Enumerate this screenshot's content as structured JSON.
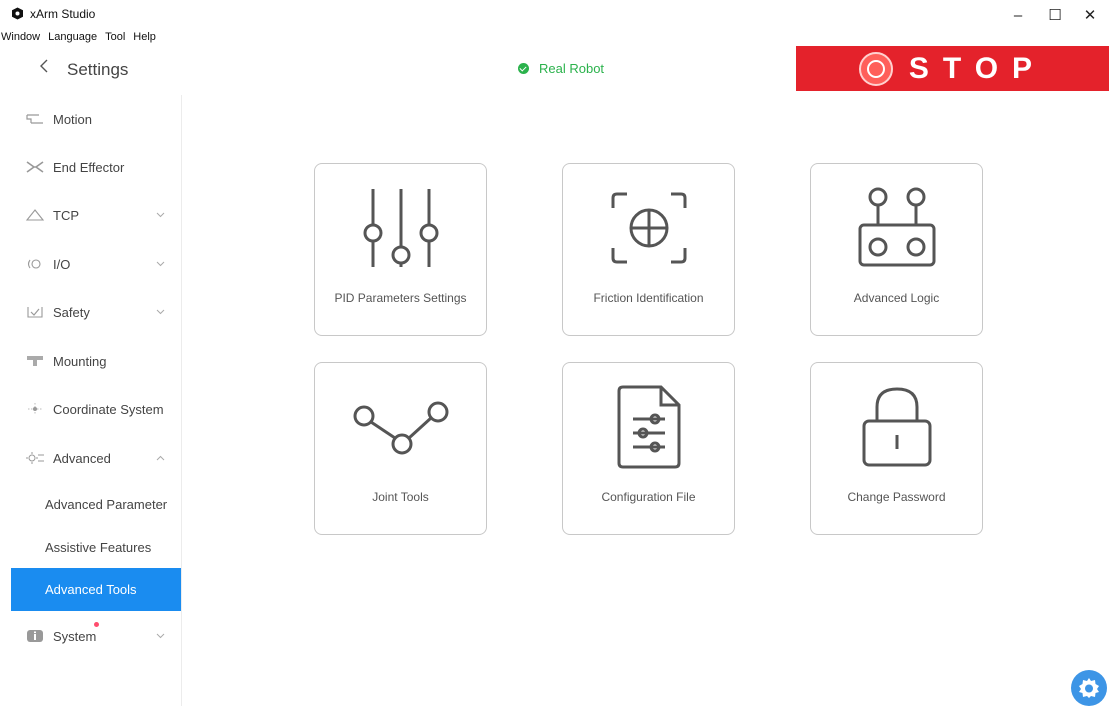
{
  "window": {
    "title": "xArm Studio",
    "controls": {
      "minimize": "–",
      "maximize": "☐",
      "close": "✕"
    }
  },
  "menu": [
    "Window",
    "Language",
    "Tool",
    "Help"
  ],
  "header": {
    "back_icon": "chevron-left-icon",
    "title": "Settings",
    "status": {
      "text": "Real Robot",
      "color": "#2bb24c"
    },
    "stop": {
      "label": "STOP",
      "color": "#e4222b"
    }
  },
  "sidebar": {
    "items": [
      {
        "label": "Motion",
        "icon": "motion-icon"
      },
      {
        "label": "End Effector",
        "icon": "end-effector-icon"
      },
      {
        "label": "TCP",
        "icon": "tcp-icon",
        "expandable": true
      },
      {
        "label": "I/O",
        "icon": "io-icon",
        "expandable": true
      },
      {
        "label": "Safety",
        "icon": "safety-icon",
        "expandable": true
      },
      {
        "label": "Mounting",
        "icon": "mounting-icon"
      },
      {
        "label": "Coordinate System",
        "icon": "coordinate-icon"
      },
      {
        "label": "Advanced",
        "icon": "advanced-icon",
        "expandable": true,
        "expanded": true
      },
      {
        "label": "System",
        "icon": "system-icon",
        "expandable": true,
        "badge": true
      }
    ],
    "advanced_sub": [
      {
        "label": "Advanced Parameter"
      },
      {
        "label": "Assistive Features"
      },
      {
        "label": "Advanced Tools",
        "active": true
      }
    ],
    "active_color": "#1a8cf0"
  },
  "cards": [
    {
      "label": "PID Parameters Settings",
      "icon": "sliders-icon"
    },
    {
      "label": "Friction Identification",
      "icon": "crosshair-icon"
    },
    {
      "label": "Advanced Logic",
      "icon": "logic-icon"
    },
    {
      "label": "Joint Tools",
      "icon": "joint-icon"
    },
    {
      "label": "Configuration File",
      "icon": "config-file-icon"
    },
    {
      "label": "Change Password",
      "icon": "lock-icon"
    }
  ]
}
